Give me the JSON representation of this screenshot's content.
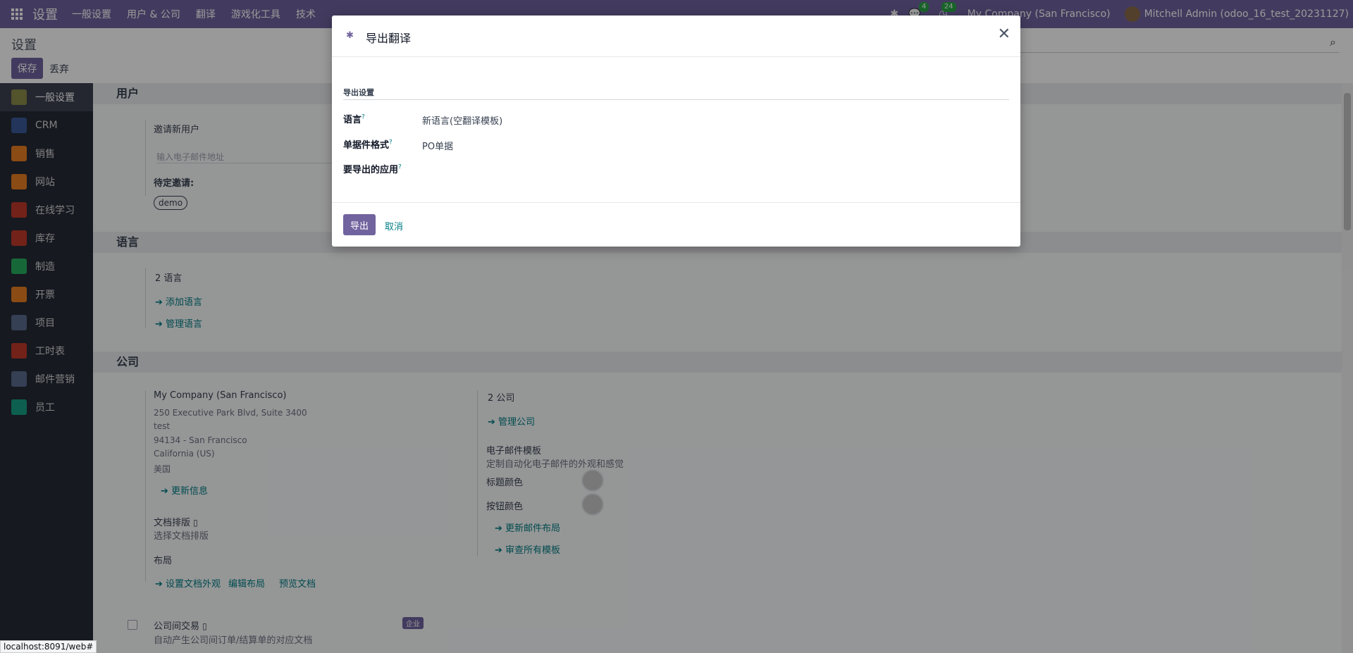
{
  "topbar": {
    "app_name": "设置",
    "menu": [
      "一般设置",
      "用户 & 公司",
      "翻译",
      "游戏化工具",
      "技术"
    ],
    "messages_count": "4",
    "activities_count": "24",
    "company": "My Company (San Francisco)",
    "user": "Mitchell Admin (odoo_16_test_20231127)"
  },
  "control_panel": {
    "breadcrumb": "设置",
    "save_label": "保存",
    "discard_label": "丢弃"
  },
  "sidebar": {
    "items": [
      {
        "label": "一般设置",
        "color": "#8a8a4a"
      },
      {
        "label": "CRM",
        "color": "#3b5998"
      },
      {
        "label": "销售",
        "color": "#e67e22"
      },
      {
        "label": "网站",
        "color": "#e67e22"
      },
      {
        "label": "在线学习",
        "color": "#c0392b"
      },
      {
        "label": "库存",
        "color": "#c0392b"
      },
      {
        "label": "制造",
        "color": "#27ae60"
      },
      {
        "label": "开票",
        "color": "#e67e22"
      },
      {
        "label": "项目",
        "color": "#5a6b8c"
      },
      {
        "label": "工时表",
        "color": "#c0392b"
      },
      {
        "label": "邮件营销",
        "color": "#5a6b8c"
      },
      {
        "label": "员工",
        "color": "#16a085"
      }
    ]
  },
  "users": {
    "title": "用户",
    "invite_label": "邀请新用户",
    "invite_placeholder": "输入电子邮件地址",
    "pending_label": "待定邀请:",
    "pending_tag": "demo"
  },
  "languages": {
    "title": "语言",
    "count": "2 语言",
    "add": "添加语言",
    "manage": "管理语言"
  },
  "companies": {
    "title": "公司",
    "name": "My Company (San Francisco)",
    "address": [
      "250 Executive Park Blvd, Suite 3400",
      "test",
      "94134 - San Francisco",
      "California (US)",
      "美国"
    ],
    "update_info": "更新信息",
    "count": "2 公司",
    "manage": "管理公司",
    "email_templates_title": "电子邮件模板",
    "email_templates_desc": "定制自动化电子邮件的外观和感觉",
    "header_color_label": "标题颜色",
    "button_color_label": "按钮颜色",
    "update_layout": "更新邮件布局",
    "review_templates": "审查所有模板",
    "doc_layout_title": "文档排版",
    "doc_layout_desc": "选择文档排版",
    "layout_label": "布局",
    "configure_layout": "设置文档外观",
    "edit_layout": "编辑布局",
    "preview_doc": "预览文档",
    "intercompany_title": "公司间交易",
    "intercompany_desc": "自动产生公司间订单/结算单的对应文档",
    "enterprise_badge": "企业"
  },
  "dialog": {
    "title": "导出翻译",
    "group_title": "导出设置",
    "lang_label": "语言",
    "lang_value": "新语言(空翻译模板)",
    "format_label": "单据件格式",
    "format_value": "PO单据",
    "modules_label": "要导出的应用",
    "export_label": "导出",
    "cancel_label": "取消"
  },
  "statusbar": {
    "url": "localhost:8091/web#"
  }
}
